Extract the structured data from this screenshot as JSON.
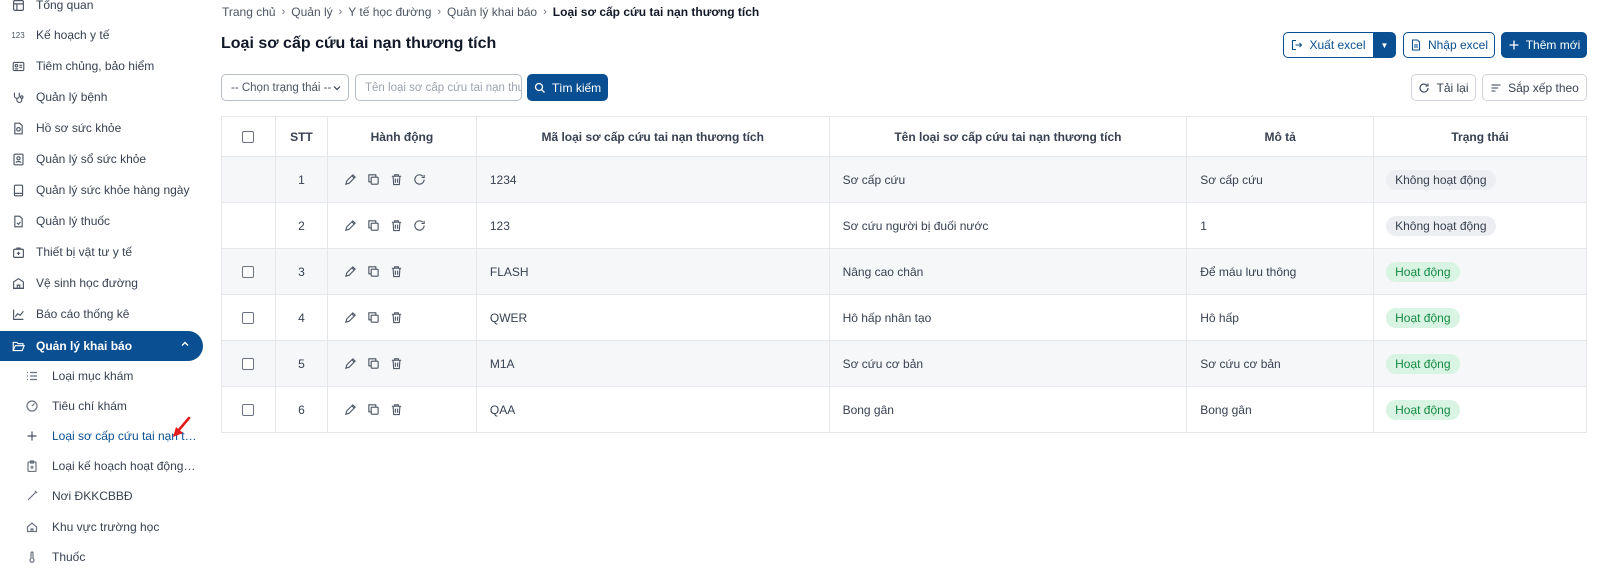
{
  "sidebar": {
    "items": [
      {
        "label": "Tổng quan",
        "icon": "dashboard-icon"
      },
      {
        "label": "Kế hoạch y tế",
        "icon": "numbers-icon"
      },
      {
        "label": "Tiêm chủng, bảo hiểm",
        "icon": "id-card-icon"
      },
      {
        "label": "Quản lý bệnh",
        "icon": "stethoscope-icon"
      },
      {
        "label": "Hồ sơ sức khỏe",
        "icon": "health-record-icon"
      },
      {
        "label": "Quản lý sổ sức khỏe",
        "icon": "contact-book-icon"
      },
      {
        "label": "Quản lý sức khỏe hàng ngày",
        "icon": "book-icon"
      },
      {
        "label": "Quản lý thuốc",
        "icon": "medicine-file-icon"
      },
      {
        "label": "Thiết bị vật tư y tế",
        "icon": "medical-kit-icon"
      },
      {
        "label": "Vệ sinh học đường",
        "icon": "school-icon"
      },
      {
        "label": "Báo cáo thống kê",
        "icon": "chart-icon"
      },
      {
        "label": "Quản lý khai báo",
        "icon": "folder-open-icon"
      }
    ],
    "subitems": [
      {
        "label": "Loại mục khám",
        "icon": "list-icon"
      },
      {
        "label": "Tiêu chí khám",
        "icon": "gauge-icon"
      },
      {
        "label": "Loại sơ cấp cứu tai nạn thương tích",
        "icon": "plus-icon"
      },
      {
        "label": "Loại kế hoạch hoạt động y tế",
        "icon": "clipboard-icon"
      },
      {
        "label": "Nơi ĐKKCBBĐ",
        "icon": "syringe-icon"
      },
      {
        "label": "Khu vực trường học",
        "icon": "home-icon"
      },
      {
        "label": "Thuốc",
        "icon": "thermometer-icon"
      }
    ]
  },
  "breadcrumb": [
    "Trang chủ",
    "Quản lý",
    "Y tế học đường",
    "Quản lý khai báo",
    "Loại sơ cấp cứu tai nạn thương tích"
  ],
  "page_title": "Loại sơ cấp cứu tai nạn thương tích",
  "toolbar": {
    "export_label": "Xuất excel",
    "import_label": "Nhập excel",
    "add_label": "Thêm mới",
    "reload_label": "Tải lại",
    "sort_label": "Sắp xếp theo"
  },
  "filters": {
    "status_select": "-- Chọn trạng thái --",
    "search_placeholder": "Tên loại sơ cấp cứu tai nạn thương tích",
    "search_button": "Tìm kiếm"
  },
  "table": {
    "headers": [
      "STT",
      "Hành động",
      "Mã loại sơ cấp cứu tai nạn thương tích",
      "Tên loại sơ cấp cứu tai nạn thương tích",
      "Mô tả",
      "Trạng thái"
    ],
    "rows": [
      {
        "stt": "1",
        "code": "1234",
        "name": "Sơ cấp cứu",
        "desc": "Sơ cấp cứu",
        "status": "Không hoạt động"
      },
      {
        "stt": "2",
        "code": "123",
        "name": "Sơ cứu người bị đuối nước",
        "desc": "1",
        "status": "Không hoạt động"
      },
      {
        "stt": "3",
        "code": "FLASH",
        "name": "Nâng cao chân",
        "desc": "Để máu lưu thông",
        "status": "Hoạt động"
      },
      {
        "stt": "4",
        "code": "QWER",
        "name": "Hô hấp nhân tạo",
        "desc": "Hô hấp",
        "status": "Hoạt động"
      },
      {
        "stt": "5",
        "code": "M1A",
        "name": "Sơ cứu cơ bản",
        "desc": "Sơ cứu cơ bản",
        "status": "Hoạt động"
      },
      {
        "stt": "6",
        "code": "QAA",
        "name": "Bong gân",
        "desc": "Bong gân",
        "status": "Hoạt động"
      }
    ]
  },
  "colors": {
    "primary": "#0a4f91",
    "active_badge_bg": "#d9f4e3",
    "active_badge_text": "#148a43",
    "inactive_badge_bg": "#eceef1"
  }
}
